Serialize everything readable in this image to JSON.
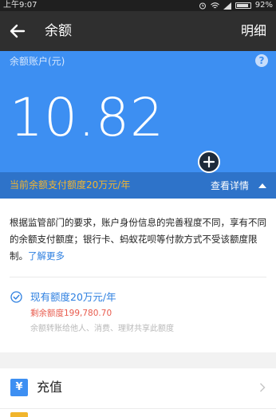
{
  "status_bar": {
    "time": "上午9:07",
    "battery": "92%",
    "battery_level": 0.92
  },
  "app_bar": {
    "title": "余额",
    "detail_label": "明细",
    "back_icon": "arrow-left-icon"
  },
  "balance": {
    "label": "余额账户(元)",
    "amount": "10.82",
    "help_glyph": "?"
  },
  "limit_bar": {
    "text": "当前余额支付额度20万元/年",
    "view_label": "查看详情"
  },
  "info": {
    "description": "根据监管部门的要求，账户身份信息的完善程度不同，享有不同的余额支付额度；银行卡、蚂蚁花呗等付款方式不受该额度限制。",
    "learn_more": "了解更多",
    "current_limit": "现有额度20万元/年",
    "remaining": "剩余额度199,780.70",
    "note": "余额转账给他人、消费、理财共享此额度"
  },
  "menu": {
    "topup_label": "充值",
    "topup_glyph": "¥"
  },
  "colors": {
    "brand_blue": "#3d8ff2",
    "limit_bar_blue": "#2e73c9",
    "warning_yellow": "#f3b52f",
    "link_blue": "#2d7fe0",
    "remaining_red": "#e85b4d"
  }
}
